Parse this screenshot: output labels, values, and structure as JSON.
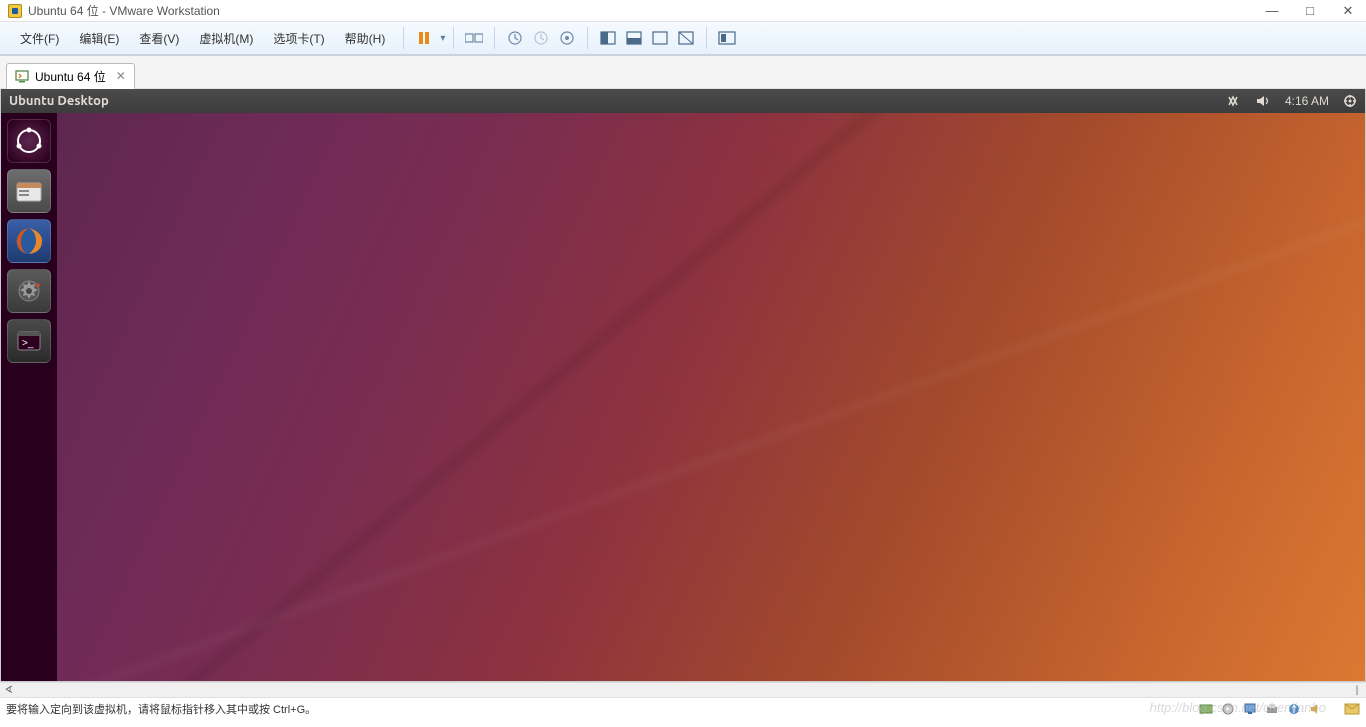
{
  "window": {
    "title": "Ubuntu 64 位 - VMware Workstation"
  },
  "menubar": {
    "file": "文件(F)",
    "edit": "编辑(E)",
    "view": "查看(V)",
    "vm": "虚拟机(M)",
    "tabs": "选项卡(T)",
    "help": "帮助(H)"
  },
  "tab": {
    "name": "Ubuntu 64 位"
  },
  "ubuntu": {
    "topbar_title": "Ubuntu Desktop",
    "time": "4:16 AM"
  },
  "statusbar": {
    "hint": "要将输入定向到该虚拟机，请将鼠标指针移入其中或按 Ctrl+G。"
  },
  "watermark": "http://blog.csdn.net/chenjianbo"
}
